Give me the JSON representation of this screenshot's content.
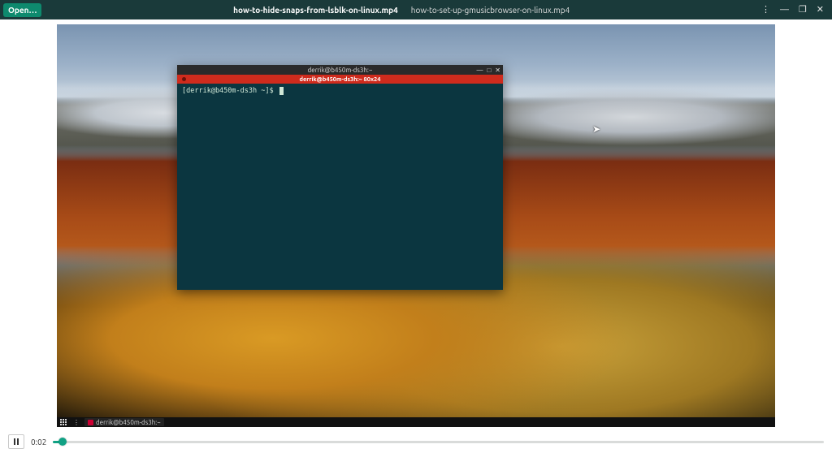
{
  "header": {
    "open_label": "Open…",
    "tabs": [
      {
        "label": "how-to-hide-snaps-from-lsblk-on-linux.mp4",
        "active": true
      },
      {
        "label": "how-to-set-up-gmusicbrowser-on-linux.mp4",
        "active": false
      }
    ]
  },
  "video": {
    "terminal": {
      "window_title": "derrik@b450m-ds3h:~",
      "tab_label": "derrik@b450m-ds3h:~ 80x24",
      "prompt_user_host": "derrik@b450m-ds3h",
      "prompt_path": "~",
      "prompt_rendered": "[derrik@b450m-ds3h ~]$"
    },
    "panel": {
      "taskbar_item": "derrik@b450m-ds3h:~"
    }
  },
  "playback": {
    "state": "playing",
    "time_label": "0:02",
    "progress_pct": 1.2
  },
  "colors": {
    "accent": "#11a184",
    "header_bg": "#1a3a3a",
    "terminal_bg": "#0b3640",
    "terminal_tab_bg": "#cf2b1d"
  }
}
